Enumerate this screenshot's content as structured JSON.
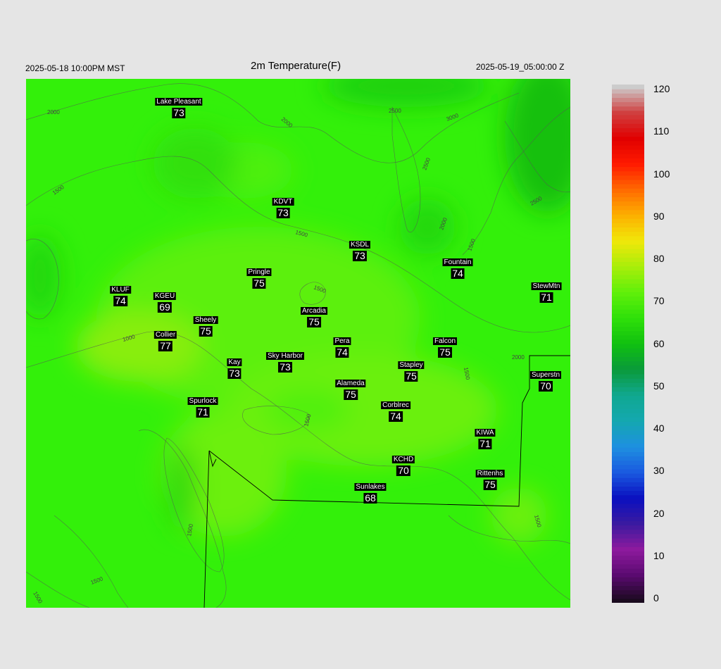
{
  "header": {
    "local_time": "2025-05-18 10:00PM MST",
    "title": "2m Temperature(F)",
    "utc_time": "2025-05-19_05:00:00 Z"
  },
  "contour_labels": [
    "2000",
    "2000",
    "2500",
    "3000",
    "2500",
    "1500",
    "1500",
    "2500",
    "2000",
    "1500",
    "1500",
    "1000",
    "2000",
    "1500",
    "1500",
    "1500",
    "1500",
    "1500",
    "1500"
  ],
  "stations": [
    {
      "name": "Lake Pleasant",
      "temp": "73"
    },
    {
      "name": "KDVT",
      "temp": "73"
    },
    {
      "name": "KSDL",
      "temp": "73"
    },
    {
      "name": "Fountain",
      "temp": "74"
    },
    {
      "name": "StewMtn",
      "temp": "71"
    },
    {
      "name": "Pringle",
      "temp": "75"
    },
    {
      "name": "KLUF",
      "temp": "74"
    },
    {
      "name": "KGEU",
      "temp": "69"
    },
    {
      "name": "Arcadia",
      "temp": "75"
    },
    {
      "name": "Sheely",
      "temp": "75"
    },
    {
      "name": "Collier",
      "temp": "77"
    },
    {
      "name": "Pera",
      "temp": "74"
    },
    {
      "name": "Falcon",
      "temp": "75"
    },
    {
      "name": "Kay",
      "temp": "73"
    },
    {
      "name": "Sky Harbor",
      "temp": "73"
    },
    {
      "name": "Stapley",
      "temp": "75"
    },
    {
      "name": "Superstn",
      "temp": "70"
    },
    {
      "name": "Alameda",
      "temp": "75"
    },
    {
      "name": "Spurlock",
      "temp": "71"
    },
    {
      "name": "Corblrec",
      "temp": "74"
    },
    {
      "name": "KIWA",
      "temp": "71"
    },
    {
      "name": "KCHD",
      "temp": "70"
    },
    {
      "name": "Rittenhs",
      "temp": "75"
    },
    {
      "name": "Sunlakes",
      "temp": "68"
    }
  ],
  "colorbar": {
    "ticks": [
      "120",
      "110",
      "100",
      "90",
      "80",
      "70",
      "60",
      "50",
      "40",
      "30",
      "20",
      "10",
      "0"
    ],
    "range": [
      0,
      120
    ],
    "colors": [
      "#1a0a1e",
      "#5a0a70",
      "#8e1a9e",
      "#3a1aa0",
      "#0a10c0",
      "#1a5ae0",
      "#1e90e0",
      "#14a8b0",
      "#10a890",
      "#0a9a3a",
      "#10c010",
      "#2ee00a",
      "#60f00a",
      "#a8ee0a",
      "#f0e80a",
      "#fdb000",
      "#ff6a00",
      "#ff1a00",
      "#e00000",
      "#d04040",
      "#cccccc"
    ]
  }
}
